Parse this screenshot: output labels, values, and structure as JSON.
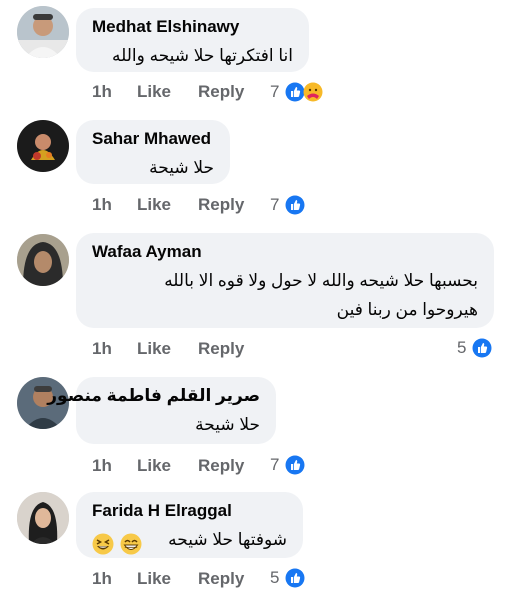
{
  "comments": [
    {
      "author": "Medhat Elshinawy",
      "text_lines": [
        "انا افتكرتها حلا شيحه والله"
      ],
      "time": "1h",
      "like_label": "Like",
      "reply_label": "Reply",
      "reaction_count": "7",
      "reactions": [
        "like",
        "care"
      ]
    },
    {
      "author": "Sahar Mhawed",
      "text_lines": [
        "حلا شيحة"
      ],
      "time": "1h",
      "like_label": "Like",
      "reply_label": "Reply",
      "reaction_count": "7",
      "reactions": [
        "like"
      ]
    },
    {
      "author": "Wafaa Ayman",
      "text_lines": [
        "بحسبها حلا شيحه  والله لا حول ولا قوه الا بالله",
        "هيروحوا من ربنا فين"
      ],
      "time": "1h",
      "like_label": "Like",
      "reply_label": "Reply",
      "reaction_count": "5",
      "reactions": [
        "like"
      ]
    },
    {
      "author": "صرير القلم فاطمة منصور",
      "text_lines": [
        "حلا شيحة"
      ],
      "time": "1h",
      "like_label": "Like",
      "reply_label": "Reply",
      "reaction_count": "7",
      "reactions": [
        "like"
      ]
    },
    {
      "author": "Farida H Elraggal",
      "text_lines": [
        "شوفتها حلا شيحه"
      ],
      "emojis": [
        "grinning-squinting-face",
        "beaming-face"
      ],
      "time": "1h",
      "like_label": "Like",
      "reply_label": "Reply",
      "reaction_count": "5",
      "reactions": [
        "like"
      ]
    }
  ],
  "colors": {
    "bubble_bg": "#f0f2f5",
    "text": "#050505",
    "secondary_text": "#65676b",
    "like_blue": "#1877f2",
    "care_yellow": "#f7b928"
  }
}
